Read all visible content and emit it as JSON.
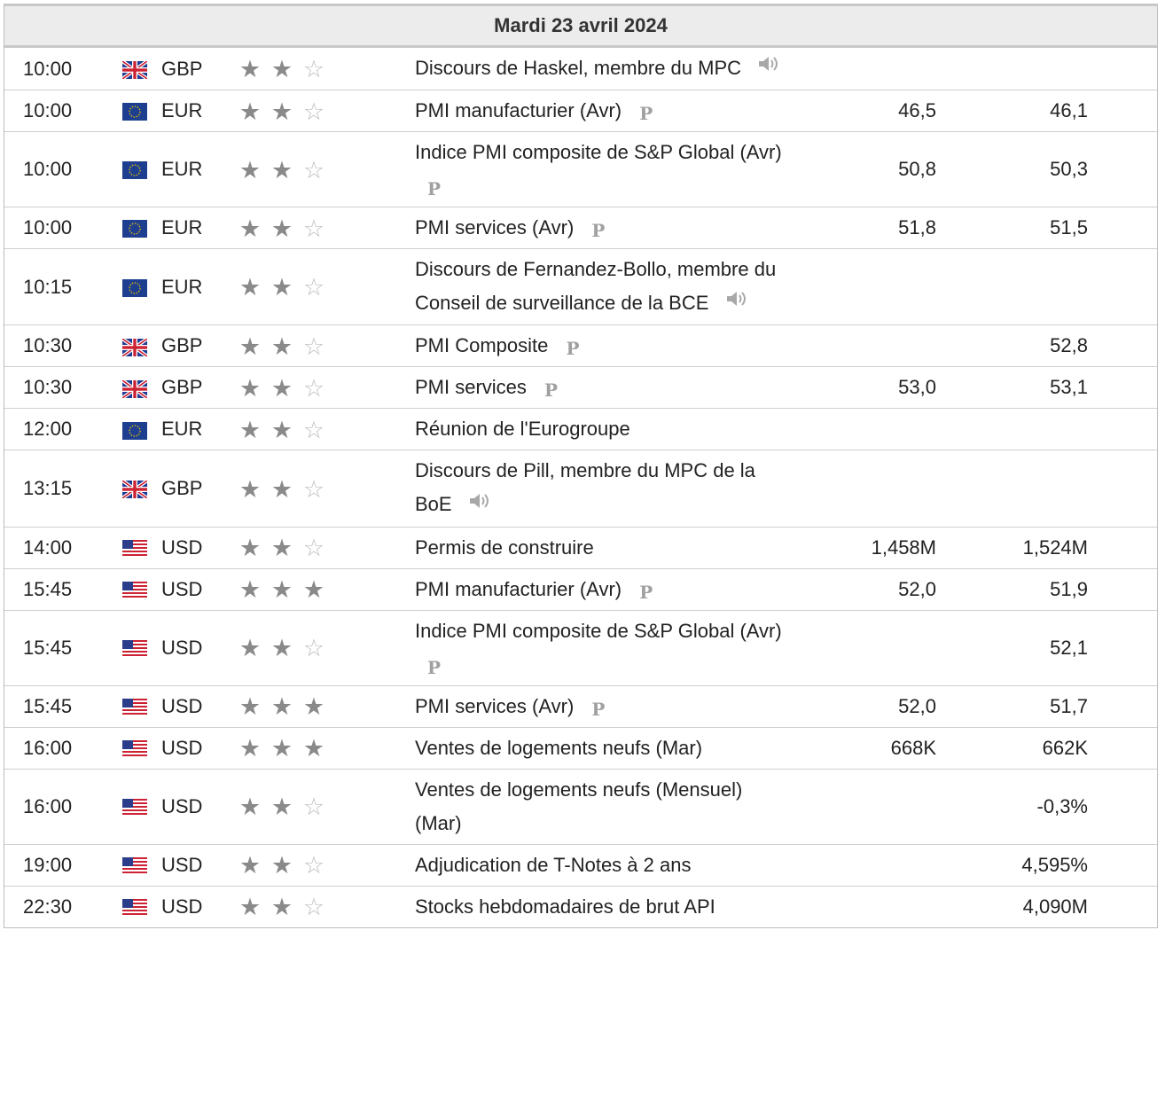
{
  "header": {
    "date": "Mardi 23 avril 2024"
  },
  "events": [
    {
      "time": "10:00",
      "flag": "uk-flag-icon",
      "currency": "GBP",
      "stars": 2,
      "title": "Discours de Haskel, membre du MPC",
      "icon": "speaker-icon",
      "actual": "",
      "forecast": "",
      "previous": ""
    },
    {
      "time": "10:00",
      "flag": "eu-flag-icon",
      "currency": "EUR",
      "stars": 2,
      "title": "PMI manufacturier (Avr)",
      "icon": "preliminary-icon",
      "actual": "46,5",
      "forecast": "46,1",
      "previous": ""
    },
    {
      "time": "10:00",
      "flag": "eu-flag-icon",
      "currency": "EUR",
      "stars": 2,
      "title": "Indice PMI composite de S&P Global (Avr)",
      "icon": "preliminary-icon",
      "actual": "50,8",
      "forecast": "50,3",
      "previous": ""
    },
    {
      "time": "10:00",
      "flag": "eu-flag-icon",
      "currency": "EUR",
      "stars": 2,
      "title": "PMI services (Avr)",
      "icon": "preliminary-icon",
      "actual": "51,8",
      "forecast": "51,5",
      "previous": ""
    },
    {
      "time": "10:15",
      "flag": "eu-flag-icon",
      "currency": "EUR",
      "stars": 2,
      "title": "Discours de Fernandez-Bollo, membre du Conseil de surveillance de la BCE",
      "icon": "speaker-icon",
      "actual": "",
      "forecast": "",
      "previous": ""
    },
    {
      "time": "10:30",
      "flag": "uk-flag-icon",
      "currency": "GBP",
      "stars": 2,
      "title": "PMI Composite",
      "icon": "preliminary-icon",
      "actual": "",
      "forecast": "52,8",
      "previous": ""
    },
    {
      "time": "10:30",
      "flag": "uk-flag-icon",
      "currency": "GBP",
      "stars": 2,
      "title": "PMI services",
      "icon": "preliminary-icon",
      "actual": "53,0",
      "forecast": "53,1",
      "previous": ""
    },
    {
      "time": "12:00",
      "flag": "eu-flag-icon",
      "currency": "EUR",
      "stars": 2,
      "title": "Réunion de l'Eurogroupe",
      "icon": "",
      "actual": "",
      "forecast": "",
      "previous": ""
    },
    {
      "time": "13:15",
      "flag": "uk-flag-icon",
      "currency": "GBP",
      "stars": 2,
      "title": "Discours de Pill, membre du MPC de la BoE",
      "icon": "speaker-icon",
      "actual": "",
      "forecast": "",
      "previous": ""
    },
    {
      "time": "14:00",
      "flag": "us-flag-icon",
      "currency": "USD",
      "stars": 2,
      "title": "Permis de construire",
      "icon": "",
      "actual": "1,458M",
      "forecast": "1,524M",
      "previous": ""
    },
    {
      "time": "15:45",
      "flag": "us-flag-icon",
      "currency": "USD",
      "stars": 3,
      "title": "PMI manufacturier (Avr)",
      "icon": "preliminary-icon",
      "actual": "52,0",
      "forecast": "51,9",
      "previous": ""
    },
    {
      "time": "15:45",
      "flag": "us-flag-icon",
      "currency": "USD",
      "stars": 2,
      "title": "Indice PMI composite de S&P Global (Avr)",
      "icon": "preliminary-icon",
      "actual": "",
      "forecast": "52,1",
      "previous": ""
    },
    {
      "time": "15:45",
      "flag": "us-flag-icon",
      "currency": "USD",
      "stars": 3,
      "title": "PMI services (Avr)",
      "icon": "preliminary-icon",
      "actual": "52,0",
      "forecast": "51,7",
      "previous": ""
    },
    {
      "time": "16:00",
      "flag": "us-flag-icon",
      "currency": "USD",
      "stars": 3,
      "title": "Ventes de logements neufs (Mar)",
      "icon": "",
      "actual": "668K",
      "forecast": "662K",
      "previous": ""
    },
    {
      "time": "16:00",
      "flag": "us-flag-icon",
      "currency": "USD",
      "stars": 2,
      "title": "Ventes de logements neufs (Mensuel) (Mar)",
      "icon": "",
      "actual": "",
      "forecast": "-0,3%",
      "previous": ""
    },
    {
      "time": "19:00",
      "flag": "us-flag-icon",
      "currency": "USD",
      "stars": 2,
      "title": "Adjudication de T-Notes à 2 ans",
      "icon": "",
      "actual": "",
      "forecast": "4,595%",
      "previous": ""
    },
    {
      "time": "22:30",
      "flag": "us-flag-icon",
      "currency": "USD",
      "stars": 2,
      "title": "Stocks hebdomadaires de brut API",
      "icon": "",
      "actual": "",
      "forecast": "4,090M",
      "previous": ""
    }
  ],
  "star_max": 3,
  "pre_icon_glyph": "P",
  "colors": {
    "star_full": "#8a8a8a",
    "star_empty": "#bdbdbd",
    "header_bg": "#ececec",
    "border": "#cfcfcf"
  }
}
